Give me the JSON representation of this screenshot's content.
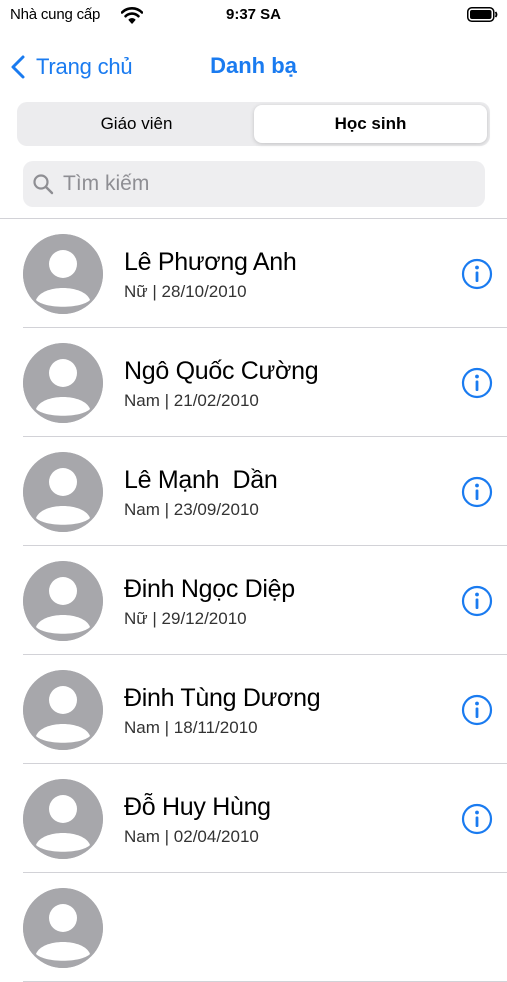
{
  "status_bar": {
    "carrier": "Nhà cung cấp",
    "time": "9:37 SA",
    "wifi_icon": "wifi-icon",
    "battery_icon": "battery-icon"
  },
  "nav": {
    "back_label": "Trang chủ",
    "title": "Danh bạ",
    "accent_color": "#1a7bf0"
  },
  "segments": {
    "left": "Giáo viên",
    "right": "Học sinh",
    "selected": "Học sinh"
  },
  "search": {
    "placeholder": "Tìm kiếm"
  },
  "contacts": [
    {
      "name": "Lê Phương Anh",
      "gender": "Nữ",
      "dob": "28/10/2010"
    },
    {
      "name": "Ngô Quốc Cường",
      "gender": "Nam",
      "dob": "21/02/2010"
    },
    {
      "name": "Lê Mạnh  Dần",
      "gender": "Nam",
      "dob": "23/09/2010"
    },
    {
      "name": "Đinh Ngọc Diệp",
      "gender": "Nữ",
      "dob": "29/12/2010"
    },
    {
      "name": "Đinh Tùng Dương",
      "gender": "Nam",
      "dob": "18/11/2010"
    },
    {
      "name": "Đỗ Huy Hùng",
      "gender": "Nam",
      "dob": "02/04/2010"
    }
  ]
}
